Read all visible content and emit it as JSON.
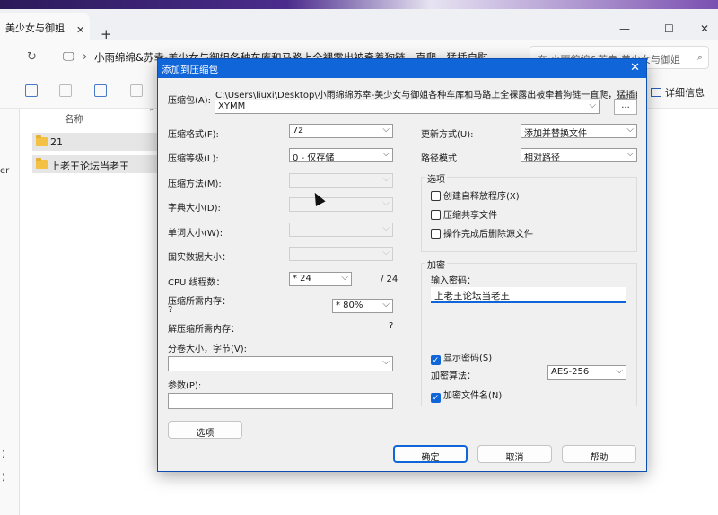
{
  "explorer": {
    "tab_title": "美少女与御姐",
    "tab_close": "✕",
    "tab_add": "+",
    "path_separator": "›",
    "address_path": "小雨绵绵&苏幸-美少女与御姐各种车库和马路上全裸露出被牵着狗链一直爬，猛插自慰",
    "search_text": "在 小雨绵绵&苏幸-美少女与御姐",
    "details_label": "详细信息",
    "column_name": "名称",
    "files": [
      {
        "name": "21"
      },
      {
        "name": "上老王论坛当老王"
      }
    ],
    "sidebar_fragments": [
      "er",
      ")",
      ")"
    ]
  },
  "dialog": {
    "title": "添加到压缩包",
    "close": "✕",
    "archive_label": "压缩包(A):",
    "archive_path": "C:\\Users\\liuxi\\Desktop\\小雨绵绵苏幸-美少女与御姐各种车库和马路上全裸露出被牵着狗链一直爬，猛插自慰到",
    "archive_name": "XYMM",
    "browse_label": "...",
    "format_label": "压缩格式(F):",
    "format_value": "7z",
    "level_label": "压缩等级(L):",
    "level_value": "0 - 仅存储",
    "method_label": "压缩方法(M):",
    "dict_label": "字典大小(D):",
    "word_label": "单词大小(W):",
    "solid_label": "固实数据大小：",
    "cpu_label": "CPU 线程数：",
    "cpu_value": "* 24",
    "cpu_total": "/ 24",
    "mem_label": "压缩所需内存：",
    "mem_q": "?",
    "mem_value": "* 80%",
    "decomp_label": "解压缩所需内存：",
    "decomp_q": "?",
    "volume_label": "分卷大小，字节(V):",
    "params_label": "参数(P):",
    "options_button": "选项",
    "update_label": "更新方式(U):",
    "update_value": "添加并替换文件",
    "pathmode_label": "路径模式",
    "pathmode_value": "相对路径",
    "options_group": "选项",
    "opt_sfx": "创建自释放程序(X)",
    "opt_shared": "压缩共享文件",
    "opt_delete": "操作完成后删除源文件",
    "encrypt_group": "加密",
    "pwd_label": "输入密码：",
    "pwd_value": "上老王论坛当老王",
    "show_pwd": "显示密码(S)",
    "enc_method_label": "加密算法：",
    "enc_method_value": "AES-256",
    "enc_names": "加密文件名(N)",
    "check_mark": "✓",
    "ok": "确定",
    "cancel": "取消",
    "help": "帮助"
  },
  "colors": {
    "accent": "#1065d8",
    "folder": "#f3c245"
  }
}
